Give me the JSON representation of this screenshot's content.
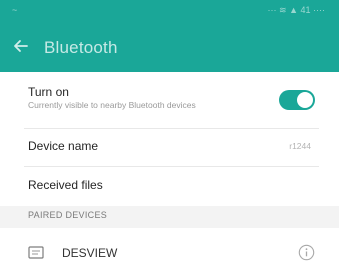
{
  "status_bar": {
    "left_text": "~",
    "right_text": "··· ≋ ▲ 41 ····"
  },
  "app_bar": {
    "title": "Bluetooth",
    "back_icon": "arrow-left-icon"
  },
  "settings": {
    "turn_on": {
      "label": "Turn on",
      "subtitle": "Currently visible to nearby Bluetooth devices",
      "toggle_on": true
    },
    "device_name": {
      "label": "Device name",
      "value": "r1244"
    },
    "received_files": {
      "label": "Received files"
    }
  },
  "paired_devices": {
    "header": "PAIRED DEVICES",
    "items": [
      {
        "name": "DESVIEW",
        "icon": "computer-icon",
        "action_icon": "info-icon"
      }
    ]
  },
  "colors": {
    "accent": "#1aa798",
    "background": "#ffffff",
    "section_background": "#f3f3f3"
  }
}
